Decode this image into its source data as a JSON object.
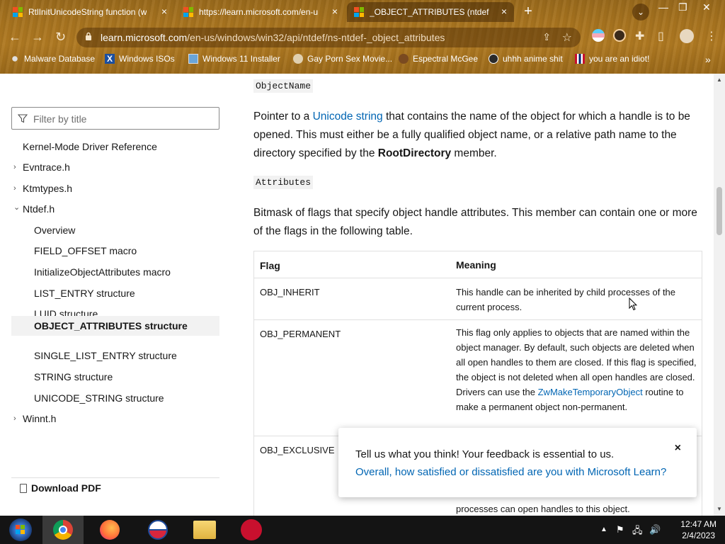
{
  "browser": {
    "tabs": [
      {
        "title": "RtlInitUnicodeString function (w",
        "active": false
      },
      {
        "title": "https://learn.microsoft.com/en-u",
        "active": false
      },
      {
        "title": "_OBJECT_ATTRIBUTES (ntdef",
        "active": true
      }
    ],
    "new_tab_label": "+",
    "url_domain": "learn.microsoft.com",
    "url_path": "/en-us/windows/win32/api/ntdef/ns-ntdef-_object_attributes",
    "bookmarks": [
      {
        "label": "Malware Database",
        "icon": "bug-icon"
      },
      {
        "label": "Windows ISOs",
        "icon": "x-icon"
      },
      {
        "label": "Windows 11 Installer",
        "icon": "image-icon"
      },
      {
        "label": "Gay Porn Sex Movie...",
        "icon": "globe-icon"
      },
      {
        "label": "Espectral McGee",
        "icon": "avatar-icon"
      },
      {
        "label": "uhhh anime shit",
        "icon": "avatar-icon"
      },
      {
        "label": "you are an idiot!",
        "icon": "flag-icon"
      }
    ],
    "bookmarks_more": "»"
  },
  "sidebar": {
    "filter_placeholder": "Filter by title",
    "items": [
      {
        "label": "Kernel-Mode Driver Reference",
        "level": 0,
        "chevron": ""
      },
      {
        "label": "Evntrace.h",
        "level": 0,
        "chevron": "›"
      },
      {
        "label": "Ktmtypes.h",
        "level": 0,
        "chevron": "›"
      },
      {
        "label": "Ntdef.h",
        "level": 0,
        "chevron": "⌄"
      },
      {
        "label": "Overview",
        "level": 1,
        "chevron": ""
      },
      {
        "label": "FIELD_OFFSET macro",
        "level": 1,
        "chevron": ""
      },
      {
        "label": "InitializeObjectAttributes macro",
        "level": 1,
        "chevron": ""
      },
      {
        "label": "LIST_ENTRY structure",
        "level": 1,
        "chevron": ""
      },
      {
        "label": "LUID structure",
        "level": 1,
        "chevron": ""
      },
      {
        "label": "OBJECT_ATTRIBUTES structure",
        "level": 1,
        "chevron": "",
        "selected": true
      },
      {
        "label": "SINGLE_LIST_ENTRY structure",
        "level": 1,
        "chevron": ""
      },
      {
        "label": "STRING structure",
        "level": 1,
        "chevron": ""
      },
      {
        "label": "UNICODE_STRING structure",
        "level": 1,
        "chevron": ""
      },
      {
        "label": "Winnt.h",
        "level": 0,
        "chevron": "›"
      }
    ],
    "download_label": "Download PDF"
  },
  "content": {
    "member1_name": "ObjectName",
    "member1_desc_pre": "Pointer to a ",
    "member1_desc_link": "Unicode string",
    "member1_desc_mid": " that contains the name of the object for which a handle is to be opened. This must either be a fully qualified object name, or a relative path name to the directory specified by the ",
    "member1_desc_bold": "RootDirectory",
    "member1_desc_post": " member.",
    "member2_name": "Attributes",
    "member2_desc": "Bitmask of flags that specify object handle attributes. This member can contain one or more of the flags in the following table.",
    "table": {
      "headers": [
        "Flag",
        "Meaning"
      ],
      "rows": [
        {
          "flag": "OBJ_INHERIT",
          "meaning": "This handle can be inherited by child processes of the current process."
        },
        {
          "flag": "OBJ_PERMANENT",
          "meaning_pre": "This flag only applies to objects that are named within the object manager. By default, such objects are deleted when all open handles to them are closed. If this flag is specified, the object is not deleted when all open handles are closed. Drivers can use the ",
          "meaning_link": "ZwMakeTemporaryObject",
          "meaning_post": " routine to make a permanent object non-permanent."
        },
        {
          "flag": "OBJ_EXCLUSIVE",
          "meaning": "processes can open handles to this object."
        }
      ]
    }
  },
  "feedback": {
    "line1": "Tell us what you think! Your feedback is essential to us.",
    "line2": "Overall, how satisfied or dissatisfied are you with Microsoft Learn?",
    "close": "×"
  },
  "taskbar": {
    "apps": [
      "start-orb",
      "chrome",
      "firefox",
      "obama-logo",
      "file-explorer",
      "red-animal-app"
    ],
    "time": "12:47 AM",
    "date": "2/4/2023"
  }
}
